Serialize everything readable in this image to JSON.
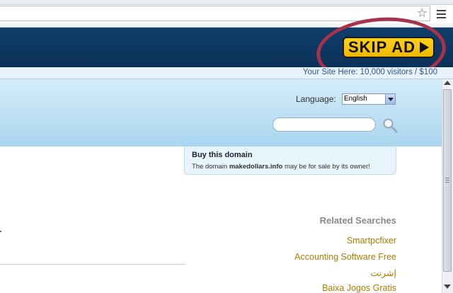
{
  "ad": {
    "skip_label": "SKIP AD",
    "strip_text": "Your Site Here: 10,000 visitors / $100"
  },
  "header": {
    "language_label": "Language:",
    "language_value": "English",
    "search_value": ""
  },
  "buy_domain": {
    "title": "Buy this domain",
    "desc_prefix": "The domain ",
    "domain": "makedollars.info",
    "desc_suffix": " may be for sale by its owner!"
  },
  "related": {
    "title": "Related Searches",
    "items": [
      "Smartpcfixer",
      "Accounting Software Free",
      "إشرنت",
      "Baixa Jogos Gratis"
    ]
  },
  "colors": {
    "banner": "#0b3158",
    "skip_button": "#f5c000",
    "annotation_circle": "#a8324a",
    "link": "#b07c00"
  },
  "icons": {
    "bookmark": "star-icon",
    "menu": "menu-icon",
    "search": "magnifier-icon",
    "skip": "play-arrow-icon"
  }
}
